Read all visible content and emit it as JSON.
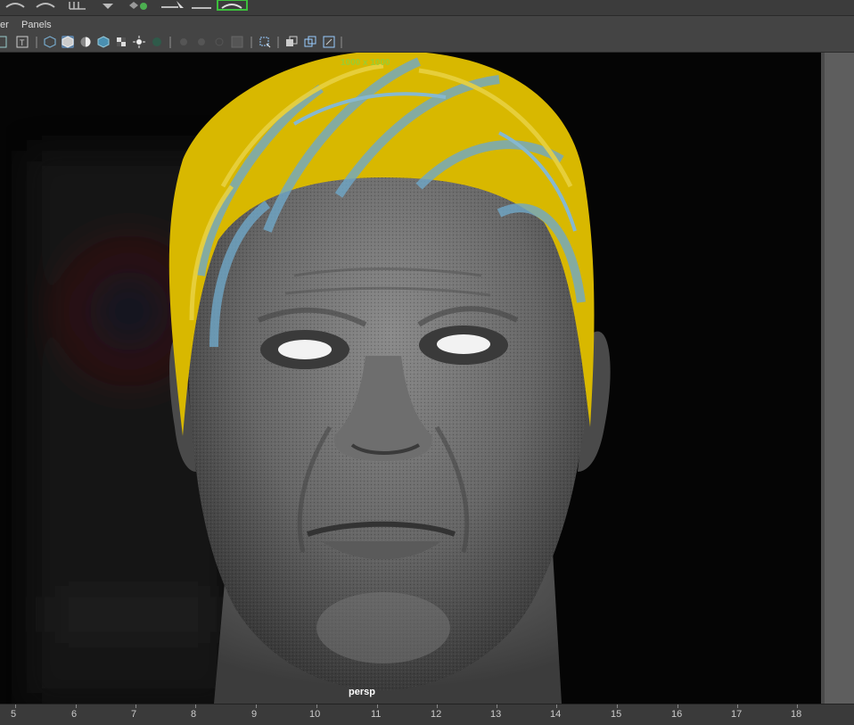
{
  "menu": {
    "items": [
      "er",
      "Panels"
    ]
  },
  "viewport": {
    "resolution_gate": "1000 x 1000",
    "camera": "persp"
  },
  "timeline": {
    "ticks": [
      "5",
      "6",
      "7",
      "8",
      "9",
      "10",
      "11",
      "12",
      "13",
      "14",
      "15",
      "16",
      "17",
      "18"
    ]
  },
  "colors": {
    "hair_yellow": "#d8b800",
    "hair_blue": "#6fa8c8",
    "resolution_text": "#9acd32",
    "active_icon": "#5b7fa3"
  }
}
